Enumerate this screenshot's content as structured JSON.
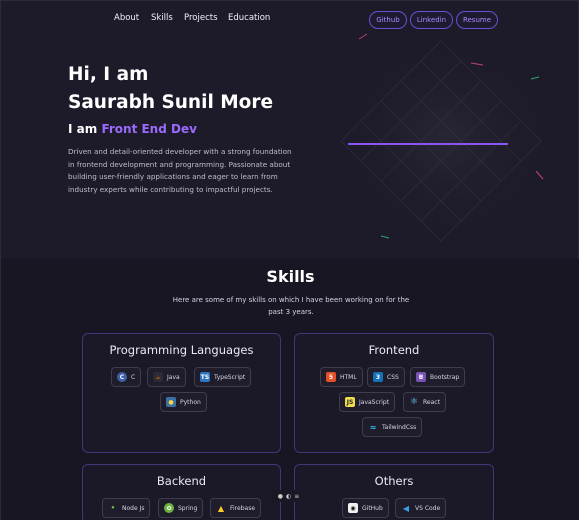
{
  "nav": {
    "links": [
      "About",
      "Skills",
      "Projects",
      "Education"
    ],
    "buttons": [
      "Github",
      "Linkedin",
      "Resume"
    ]
  },
  "hero": {
    "greeting": "Hi, I am",
    "name": "Saurabh Sunil More",
    "role_prefix": "I am",
    "role_highlight": "Front End Dev",
    "description": "Driven and detail-oriented developer with a strong foundation in frontend development and programming. Passionate about building user-friendly applications and eager to learn from industry experts while contributing to impactful projects."
  },
  "skills": {
    "title": "Skills",
    "subtitle": "Here are some of my skills on which I have been working on for the past 3 years.",
    "cards": [
      {
        "title": "Programming Languages",
        "items": [
          "C",
          "Java",
          "TypeScript",
          "Python"
        ]
      },
      {
        "title": "Frontend",
        "items": [
          "HTML",
          "CSS",
          "Bootstrap",
          "JavaScript",
          "React",
          "TailwindCss"
        ]
      },
      {
        "title": "Backend",
        "items": [
          "Node Js",
          "Spring",
          "Firebase"
        ]
      },
      {
        "title": "Others",
        "items": [
          "GitHub",
          "VS Code"
        ]
      }
    ]
  },
  "colors": {
    "accent": "#9b6bff",
    "background": "#1d1b29",
    "card_border": "#43357a"
  },
  "icons": {
    "C": "c-logo-icon",
    "Java": "java-icon",
    "TypeScript": "typescript-icon",
    "Python": "python-icon",
    "HTML": "html5-icon",
    "CSS": "css3-icon",
    "Bootstrap": "bootstrap-icon",
    "JavaScript": "javascript-icon",
    "React": "react-icon",
    "TailwindCss": "tailwind-icon",
    "Node Js": "nodejs-icon",
    "Spring": "spring-icon",
    "Firebase": "firebase-icon",
    "GitHub": "github-icon",
    "VS Code": "vscode-icon"
  }
}
